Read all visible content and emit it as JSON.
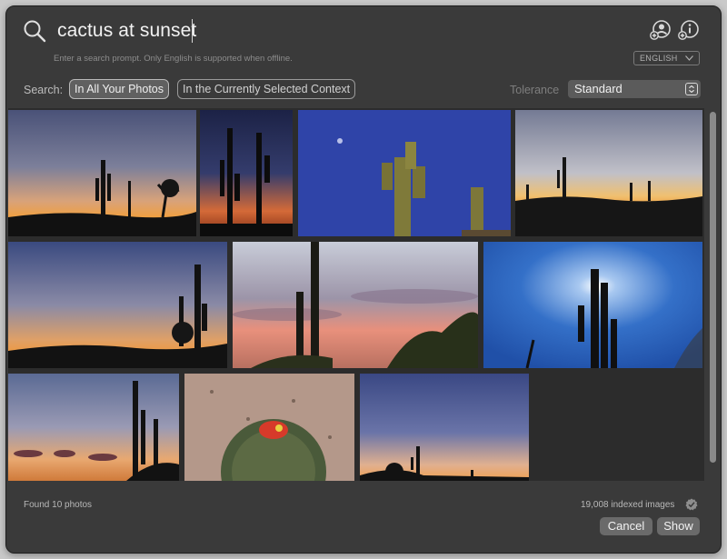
{
  "search": {
    "query": "cactus at sunset",
    "hint": "Enter a search prompt. Only English is supported when offline.",
    "language": "ENGLISH"
  },
  "header_icons": [
    "add-person-icon",
    "add-info-icon"
  ],
  "scope": {
    "label": "Search:",
    "options": [
      "In All Your Photos",
      "In the Currently Selected Context"
    ],
    "selected": "In All Your Photos"
  },
  "tolerance": {
    "label": "Tolerance",
    "value": "Standard"
  },
  "photos": [
    {
      "id": 1,
      "scene": "sunset-saguaro-joshua"
    },
    {
      "id": 2,
      "scene": "dusk-twin-saguaros"
    },
    {
      "id": 3,
      "scene": "blue-sky-saguaro-moon"
    },
    {
      "id": 4,
      "scene": "sunset-horizon-cacti"
    },
    {
      "id": 5,
      "scene": "sunset-saguaro-shrub"
    },
    {
      "id": 6,
      "scene": "pink-clouds-saguaro"
    },
    {
      "id": 7,
      "scene": "sunburst-saguaro"
    },
    {
      "id": 8,
      "scene": "sunset-clouds-saguaro"
    },
    {
      "id": 9,
      "scene": "barrel-cactus-red"
    },
    {
      "id": 10,
      "scene": "twilight-small-saguaro"
    }
  ],
  "footer": {
    "found": "Found 10 photos",
    "indexed": "19,008 indexed images",
    "cancel_label": "Cancel",
    "show_label": "Show"
  },
  "colors": {
    "window_bg": "#3a3a3a",
    "grid_bg": "#2c2c2c",
    "button_bg": "#6a6a6a"
  }
}
